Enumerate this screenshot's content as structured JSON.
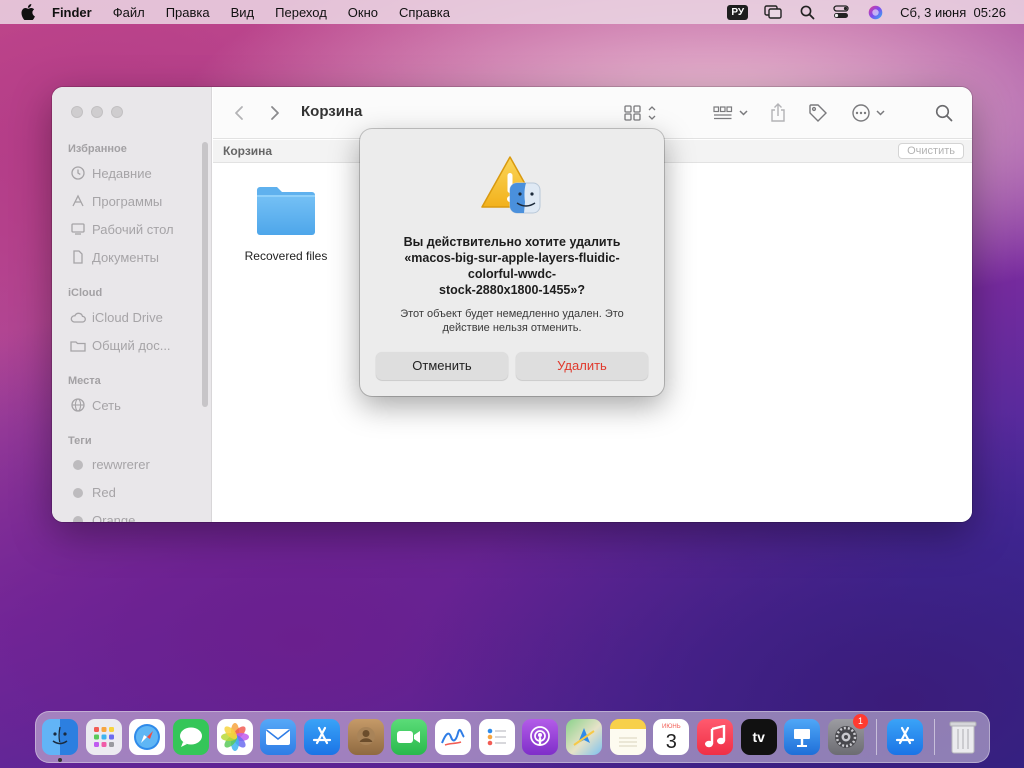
{
  "menubar": {
    "app_name": "Finder",
    "items": [
      "Файл",
      "Правка",
      "Вид",
      "Переход",
      "Окно",
      "Справка"
    ],
    "lang": "РУ",
    "datetime": "Сб, 3 июня  05:26"
  },
  "finder": {
    "title": "Корзина",
    "path_label": "Корзина",
    "clear_label": "Очистить",
    "sidebar": {
      "favorites_header": "Избранное",
      "favorites": [
        "Недавние",
        "Программы",
        "Рабочий стол",
        "Документы"
      ],
      "icloud_header": "iCloud",
      "icloud": [
        "iCloud Drive",
        "Общий дос..."
      ],
      "places_header": "Места",
      "places": [
        "Сеть"
      ],
      "tags_header": "Теги",
      "tags": [
        "rewwrerer",
        "Red",
        "Orange"
      ]
    },
    "files": [
      {
        "name": "Recovered files",
        "icon": "folder-icon"
      }
    ]
  },
  "dialog": {
    "title": "Вы действительно хотите удалить «macos-big-sur-apple-layers-fluidic-colorful-wwdc-stock-2880x1800-1455»?",
    "title_lines": [
      "Вы действительно хотите удалить",
      "«macos-big-sur-apple-layers-fluidic-",
      "colorful-wwdc-",
      "stock-2880x1800-1455»?"
    ],
    "body": "Этот объект будет немедленно удален. Это действие нельзя отменить.",
    "body_lines": [
      "Этот объект будет немедленно удален. Это",
      "действие нельзя отменить."
    ],
    "cancel_label": "Отменить",
    "delete_label": "Удалить",
    "delete_color": "#e0392c"
  },
  "dock": {
    "apps": [
      {
        "name": "finder-icon",
        "color": "#3a8ee6"
      },
      {
        "name": "launchpad-icon",
        "color": "#e9e9ef"
      },
      {
        "name": "safari-icon",
        "color": "#2f8bea"
      },
      {
        "name": "messages-icon",
        "color": "#35c659"
      },
      {
        "name": "photos-icon",
        "color": "#ffffff"
      },
      {
        "name": "mail-icon",
        "color": "#3b86ee"
      },
      {
        "name": "app-store-icon",
        "color": "#2a8cf0"
      },
      {
        "name": "contacts-icon",
        "color": "#a87b4f"
      },
      {
        "name": "facetime-icon",
        "color": "#33c65a"
      },
      {
        "name": "freeform-icon",
        "color": "#ffffff"
      },
      {
        "name": "reminders-icon",
        "color": "#ffffff"
      },
      {
        "name": "podcasts-icon",
        "color": "#9b44d6"
      },
      {
        "name": "maps-icon",
        "color": "#6ac46b"
      },
      {
        "name": "notes-icon",
        "color": "#f7d04a"
      },
      {
        "name": "calendar-icon",
        "color": "#ffffff"
      },
      {
        "name": "music-icon",
        "color": "#f6354a"
      },
      {
        "name": "apple-tv-icon",
        "color": "#111111"
      },
      {
        "name": "keynote-icon",
        "color": "#1f7fe6"
      },
      {
        "name": "system-settings-icon",
        "color": "#8a8a8e"
      }
    ],
    "calendar_month": "ИЮНЬ",
    "calendar_day": "3",
    "appletv_label": "tv",
    "settings_badge": "1",
    "extras": [
      {
        "name": "app-store-download-icon",
        "color": "#2a8cf0"
      },
      {
        "name": "trash-icon",
        "color": "#e8e8ea"
      }
    ]
  }
}
